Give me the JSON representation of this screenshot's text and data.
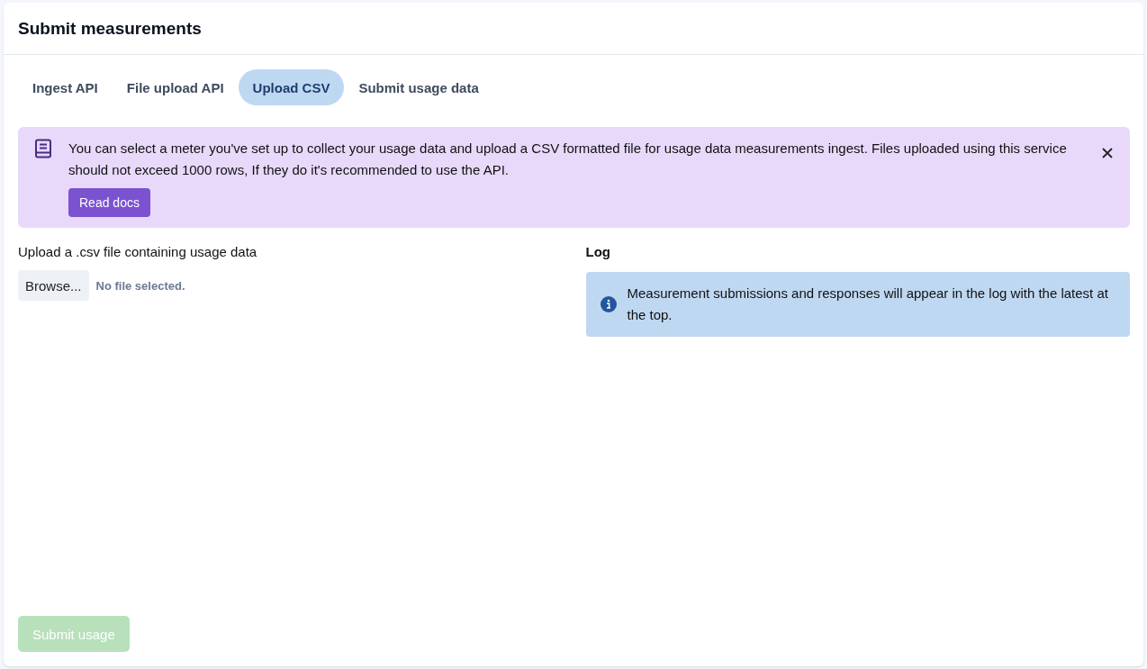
{
  "card": {
    "title": "Submit measurements"
  },
  "tabs": [
    {
      "label": "Ingest API",
      "selected": false
    },
    {
      "label": "File upload API",
      "selected": false
    },
    {
      "label": "Upload CSV",
      "selected": true
    },
    {
      "label": "Submit usage data",
      "selected": false
    }
  ],
  "notice": {
    "text": "You can select a meter you've set up to collect your usage data and upload a CSV formatted file for usage data measurements ingest. Files uploaded using this service should not exceed 1000 rows, If they do it's recommended to use the API.",
    "button": "Read docs"
  },
  "upload": {
    "label": "Upload a .csv file containing usage data",
    "browse_button": "Browse...",
    "file_status": "No file selected."
  },
  "log": {
    "title": "Log",
    "info": "Measurement submissions and responses will appear in the log with the latest at the top."
  },
  "submit_button": {
    "label": "Submit usage",
    "disabled": true
  }
}
